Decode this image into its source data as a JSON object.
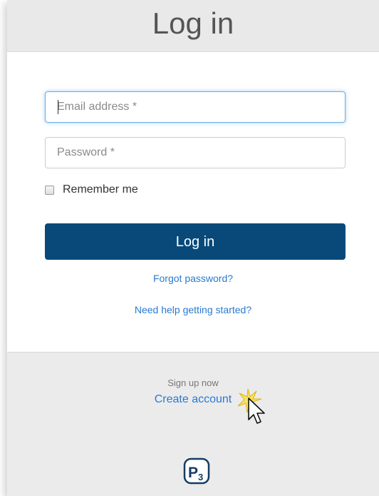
{
  "header": {
    "title": "Log in"
  },
  "form": {
    "email_placeholder": "Email address *",
    "email_value": "",
    "password_placeholder": "Password *",
    "password_value": "",
    "remember_label": "Remember me",
    "remember_checked": false,
    "submit_label": "Log in",
    "forgot_link": "Forgot password?",
    "help_link": "Need help getting started?"
  },
  "footer": {
    "signup_prompt": "Sign up now",
    "create_account_link": "Create account",
    "logo_text": "P3"
  },
  "colors": {
    "primary_button": "#08497a",
    "link": "#2a7ad0",
    "focus_ring": "#66afe9"
  },
  "icons": [
    "mouse-pointer-icon",
    "click-burst-icon",
    "p3-logo"
  ]
}
